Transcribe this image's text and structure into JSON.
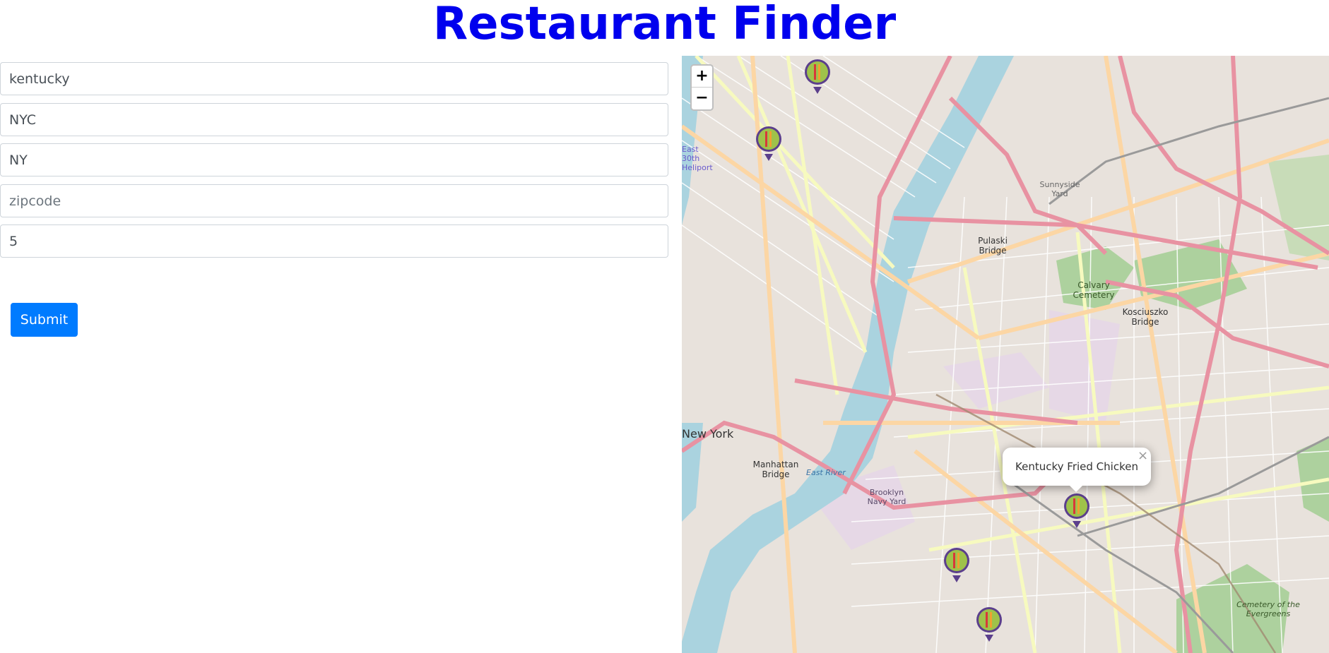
{
  "page": {
    "title": "Restaurant Finder"
  },
  "form": {
    "term": {
      "value": "kentucky",
      "placeholder": ""
    },
    "city": {
      "value": "NYC",
      "placeholder": ""
    },
    "state": {
      "value": "NY",
      "placeholder": ""
    },
    "zipcode": {
      "value": "",
      "placeholder": "zipcode"
    },
    "limit": {
      "value": "5",
      "placeholder": ""
    },
    "submit_label": "Submit"
  },
  "map": {
    "zoom_in_label": "+",
    "zoom_out_label": "−",
    "popup_text": "Kentucky Fried Chicken",
    "popup_close": "×",
    "labels": {
      "new_york": "New York",
      "manhattan_bridge": "Manhattan Bridge",
      "pulaski_bridge": "Pulaski Bridge",
      "calvary_cemetery": "Calvary Cemetery",
      "kosciuszko_bridge": "Kosciuszko Bridge",
      "navy_yard": "Brooklyn Navy Yard",
      "east_river": "East River",
      "sunnyside_yard": "Sunnyside Yard",
      "cemetery_evergreens": "Cemetery of the Evergreens",
      "heliport": "East 30th Heliport"
    },
    "colors": {
      "water": "#aad3df",
      "land": "#efe9e1",
      "park": "#add19e",
      "motorway": "#e892a2",
      "primary": "#fcd6a4",
      "secondary": "#f7fabf",
      "marker_pin": "#5b3f8c",
      "marker_fill": "#9fc24a"
    }
  },
  "colors": {
    "title": "#0000ee",
    "button": "#007bff"
  }
}
